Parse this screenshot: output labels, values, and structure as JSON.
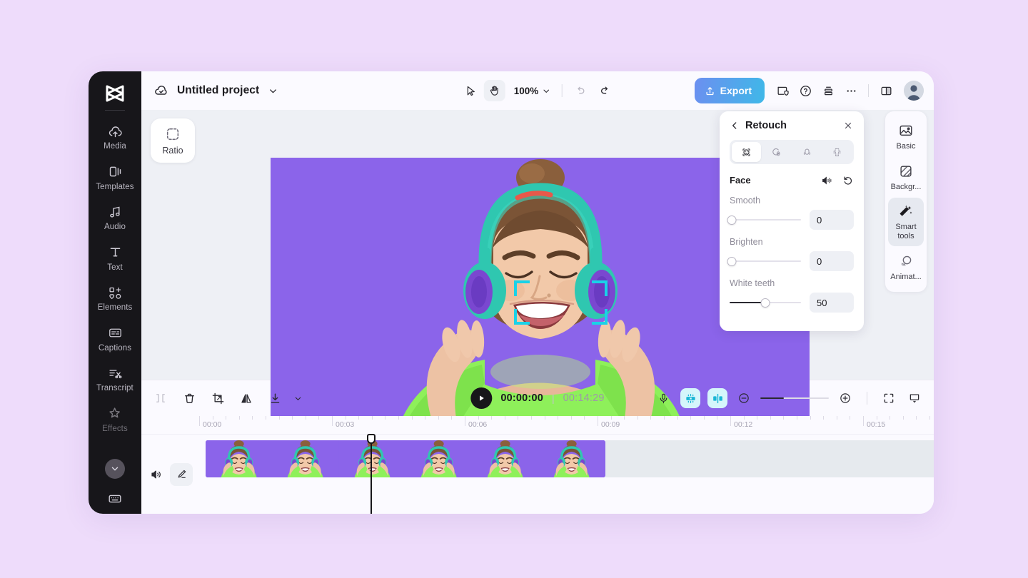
{
  "theme": {
    "page_bg": "#eedcfb",
    "rail_bg": "#17161a",
    "panel_bg": "#eef0f5",
    "accent_export_from": "#6c8ff0",
    "accent_export_to": "#3fb8e8",
    "canvas_bg": "#8b64ea",
    "face_bracket": "#19d2e8",
    "toggle_on_bg": "#d5f6fb"
  },
  "left_rail": {
    "logo_name": "capcut-logo-icon",
    "items": [
      {
        "label": "Media",
        "icon": "cloud-upload-icon",
        "dim": false
      },
      {
        "label": "Templates",
        "icon": "templates-icon",
        "dim": false
      },
      {
        "label": "Audio",
        "icon": "music-note-icon",
        "dim": false
      },
      {
        "label": "Text",
        "icon": "text-t-icon",
        "dim": false
      },
      {
        "label": "Elements",
        "icon": "elements-icon",
        "dim": false
      },
      {
        "label": "Captions",
        "icon": "captions-icon",
        "dim": false
      },
      {
        "label": "Transcript",
        "icon": "transcript-scissors-icon",
        "dim": false
      },
      {
        "label": "Effects",
        "icon": "sparkle-star-icon",
        "dim": true
      }
    ],
    "collapse_icon": "chevron-down-icon",
    "bottom_icon": "keyboard-shortcuts-icon"
  },
  "header": {
    "cloud_icon": "cloud-saved-icon",
    "project_title": "Untitled project",
    "title_caret_icon": "chevron-down-icon",
    "tools": [
      {
        "name": "select-arrow",
        "icon": "cursor-arrow-icon",
        "active": false
      },
      {
        "name": "hand-pan",
        "icon": "hand-icon",
        "active": true
      }
    ],
    "zoom_level": "100%",
    "zoom_caret_icon": "chevron-down-icon",
    "undo_icon": "undo-arrow-icon",
    "redo_icon": "redo-arrow-icon",
    "export_label": "Export",
    "export_icon": "upload-icon",
    "right_icons": [
      {
        "name": "shield-check-icon"
      },
      {
        "name": "help-question-icon"
      },
      {
        "name": "layers-icon"
      },
      {
        "name": "more-horizontal-icon"
      },
      {
        "name": "split-view-icon"
      }
    ],
    "avatar_name": "user-avatar"
  },
  "canvas": {
    "ratio_label": "Ratio",
    "ratio_icon": "dashed-square-icon",
    "face_brackets": "face-detection-brackets"
  },
  "retouch_panel": {
    "back_icon": "chevron-left-icon",
    "title": "Retouch",
    "close_icon": "close-x-icon",
    "tabs": [
      {
        "name": "face-tab",
        "icon": "face-smile-icon",
        "active": true
      },
      {
        "name": "eyes-tab",
        "icon": "eye-shape-icon",
        "active": false
      },
      {
        "name": "nose-tab",
        "icon": "nose-shape-icon",
        "active": false
      },
      {
        "name": "body-tab",
        "icon": "body-shape-icon",
        "active": false
      }
    ],
    "section_title": "Face",
    "compare_icon": "compare-icon",
    "reset_icon": "reset-rotate-icon",
    "sliders": [
      {
        "label": "Smooth",
        "value": "0",
        "percent": 0
      },
      {
        "label": "Brighten",
        "value": "0",
        "percent": 0
      },
      {
        "label": "White teeth",
        "value": "50",
        "percent": 50
      }
    ]
  },
  "right_rail": {
    "items": [
      {
        "label": "Basic",
        "icon": "image-basic-icon",
        "active": false
      },
      {
        "label": "Backgr...",
        "icon": "background-hatch-icon",
        "active": false
      },
      {
        "label": "Smart tools",
        "icon": "magic-wand-icon",
        "active": true
      },
      {
        "label": "Animat...",
        "icon": "animation-circles-icon",
        "active": false
      }
    ]
  },
  "timeline": {
    "left_tools": [
      {
        "name": "split-clip-icon"
      },
      {
        "name": "delete-trash-icon"
      },
      {
        "name": "crop-icon"
      },
      {
        "name": "mirror-flip-icon"
      },
      {
        "name": "download-icon"
      },
      {
        "name": "chevron-down-icon"
      }
    ],
    "play_icon": "play-triangle-icon",
    "current_time": "00:00:00",
    "time_separator": "|",
    "total_time": "00:14:29",
    "right_tools": [
      {
        "name": "microphone-icon",
        "active": false
      },
      {
        "name": "auto-cut-icon",
        "active": true
      },
      {
        "name": "split-center-icon",
        "active": true
      }
    ],
    "zoom_out_icon": "zoom-minus-icon",
    "zoom_in_icon": "zoom-plus-icon",
    "zoom_slider_percent": 33,
    "fit_icon": "fit-screen-icon",
    "present_icon": "presentation-icon",
    "ruler_labels": [
      "00:00",
      "00:03",
      "00:06",
      "00:09",
      "00:12",
      "00:15"
    ],
    "track_mute_icon": "speaker-icon",
    "track_edit_icon": "pencil-edit-icon",
    "clip_thumb_count": 6,
    "playhead_time": "00:00"
  }
}
